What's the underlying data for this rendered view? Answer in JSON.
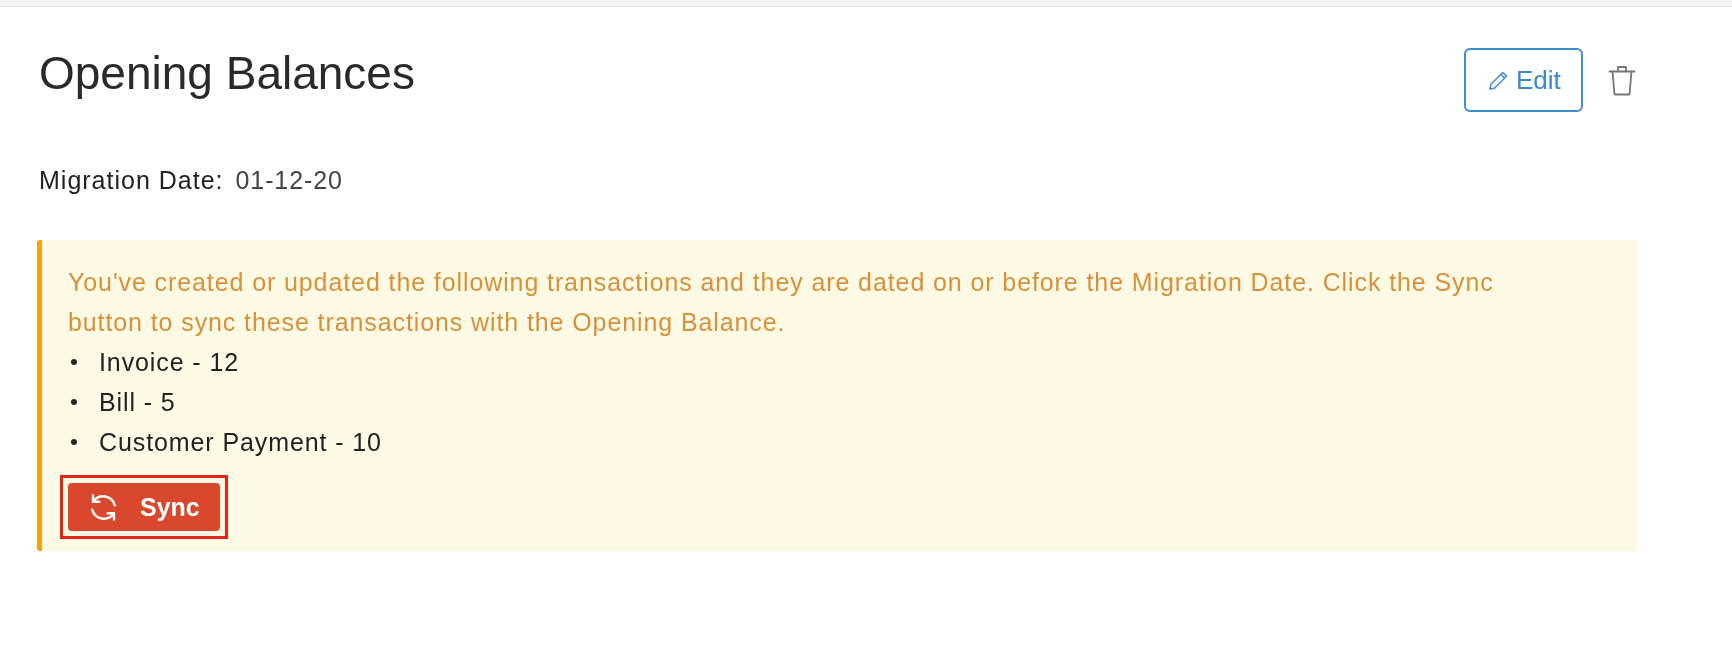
{
  "page": {
    "title": "Opening Balances"
  },
  "actions": {
    "edit_button": {
      "label": "Edit"
    }
  },
  "migration": {
    "label": "Migration Date:",
    "value": "01-12-20"
  },
  "notice": {
    "message": "You've created or updated the following transactions and they are dated on or before the Migration Date. Click the Sync button to sync these transactions with the Opening Balance.",
    "transactions": [
      "Invoice - 12",
      "Bill - 5",
      "Customer Payment - 10"
    ],
    "sync_button": {
      "label": "Sync",
      "highlighted": true
    }
  }
}
